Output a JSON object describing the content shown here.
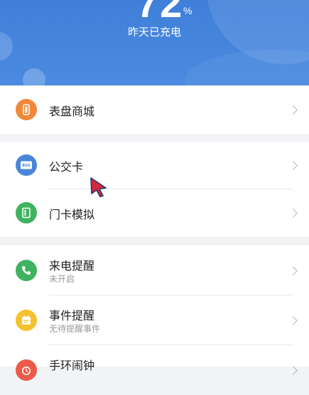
{
  "header": {
    "battery_percent": "72",
    "battery_unit": "%",
    "battery_status": "昨天已充电"
  },
  "menu": {
    "watch_store": {
      "label": "表盘商城",
      "icon": "watch-icon",
      "color": "#f0883a"
    },
    "bus_card": {
      "label": "公交卡",
      "icon": "bus-card-icon",
      "color": "#4a86d8",
      "icon_text": "BUS"
    },
    "door_card": {
      "label": "门卡模拟",
      "icon": "door-card-icon",
      "color": "#3fb35f"
    },
    "call_reminder": {
      "label": "来电提醒",
      "sub": "未开启",
      "icon": "phone-icon",
      "color": "#3fb35f"
    },
    "event_reminder": {
      "label": "事件提醒",
      "sub": "无待提醒事件",
      "icon": "calendar-icon",
      "color": "#f5c22e"
    },
    "alarm": {
      "label": "手环闹钟",
      "icon": "alarm-clock-icon",
      "color": "#ec5a4a"
    }
  }
}
